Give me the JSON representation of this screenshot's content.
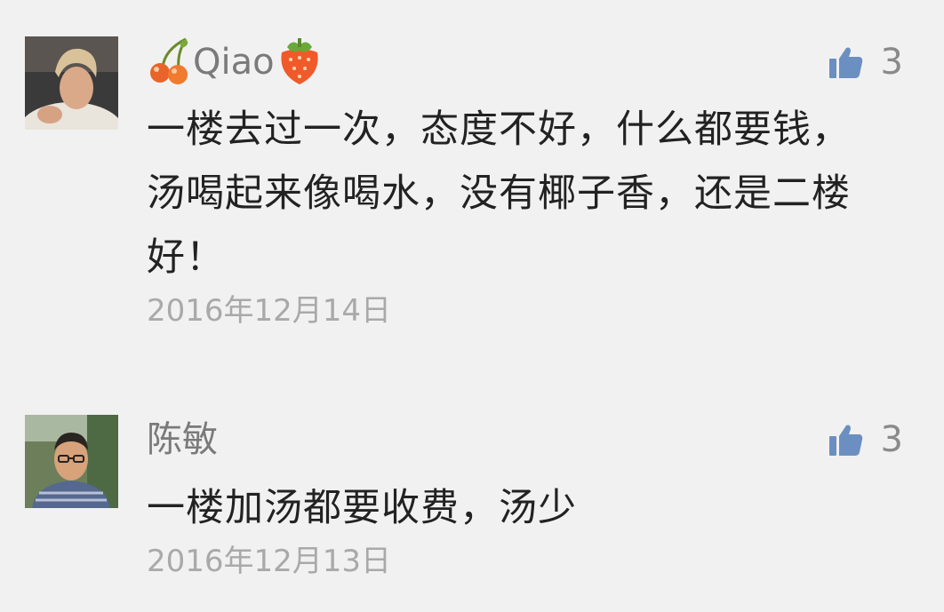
{
  "comments": [
    {
      "username": "Qiao",
      "username_prefix_icon": "cherry-icon",
      "username_suffix_icon": "strawberry-icon",
      "like_icon": "thumbs-up-icon",
      "like_count": "3",
      "content": "一楼去过一次，态度不好，什么都要钱，汤喝起来像喝水，没有椰子香，还是二楼好！",
      "date": "2016年12月14日"
    },
    {
      "username": "陈敏",
      "like_icon": "thumbs-up-icon",
      "like_count": "3",
      "content": "一楼加汤都要收费，汤少",
      "date": "2016年12月13日"
    }
  ],
  "colors": {
    "background": "#f1f1f1",
    "username": "#7a7a7a",
    "content": "#222222",
    "date": "#a9a9a9",
    "like_icon": "#6b8fc0"
  }
}
